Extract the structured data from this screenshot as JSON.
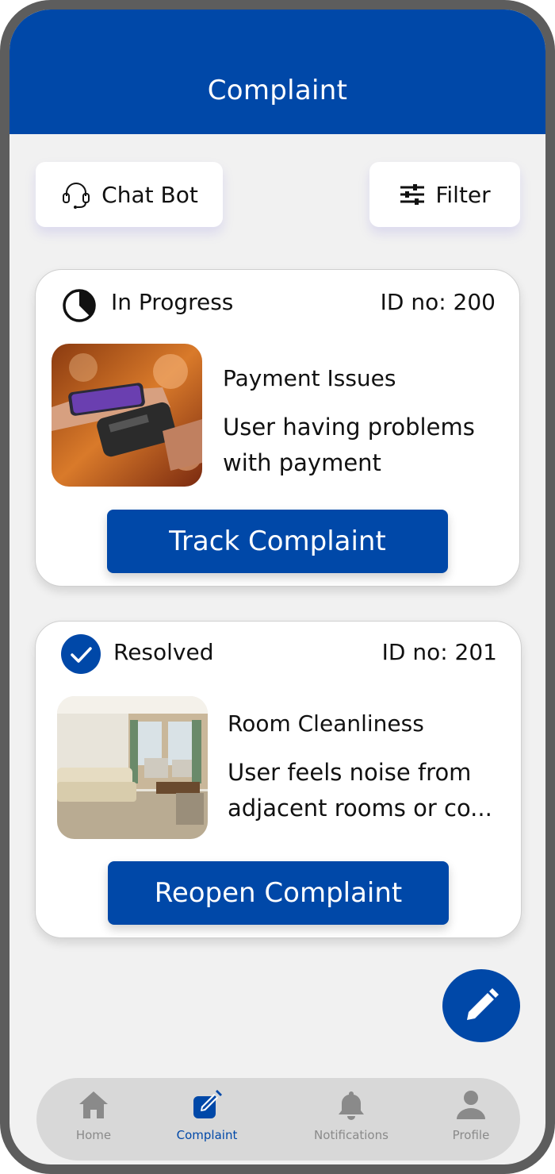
{
  "header": {
    "title": "Complaint"
  },
  "toolbar": {
    "chat_bot_label": "Chat Bot",
    "filter_label": "Filter"
  },
  "complaints": [
    {
      "status": "In Progress",
      "id_label": "ID no: 200",
      "title": "Payment Issues",
      "description": "User having problems with payment",
      "action_label": "Track Complaint",
      "status_icon": "progress-pie-icon",
      "image": "card-payment-photo"
    },
    {
      "status": "Resolved",
      "id_label": "ID no: 201",
      "title": "Room Cleanliness",
      "description": "User feels noise from adjacent rooms or co...",
      "action_label": "Reopen Complaint",
      "status_icon": "check-circle-icon",
      "image": "hotel-room-photo"
    }
  ],
  "fab": {
    "icon": "pencil-icon"
  },
  "bottom_nav": [
    {
      "label": "Home",
      "icon": "home-icon",
      "active": false
    },
    {
      "label": "Complaint",
      "icon": "edit-square-icon",
      "active": true
    },
    {
      "label": "Notifications",
      "icon": "bell-icon",
      "active": false
    },
    {
      "label": "Profile",
      "icon": "user-icon",
      "active": false
    }
  ],
  "colors": {
    "primary": "#0048a8",
    "background": "#f1f1f1",
    "nav_inactive": "#8a8a8a"
  }
}
